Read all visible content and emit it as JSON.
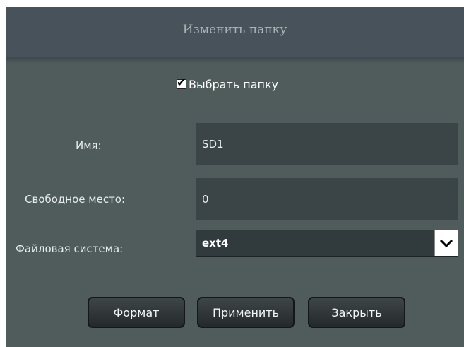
{
  "dialog": {
    "title": "Изменить папку"
  },
  "select_folder": {
    "checked": true,
    "label": "Выбрать папку"
  },
  "fields": {
    "name_label": "Имя:",
    "name_value": "SD1",
    "free_space_label": "Свободное место:",
    "free_space_value": "0",
    "filesystem_label": "Файловая система:",
    "filesystem_value": "ext4"
  },
  "buttons": {
    "format": "Формат",
    "apply": "Применить",
    "close": "Закрыть"
  },
  "icons": {
    "checkbox": "check-icon",
    "dropdown": "chevron-down-icon"
  }
}
